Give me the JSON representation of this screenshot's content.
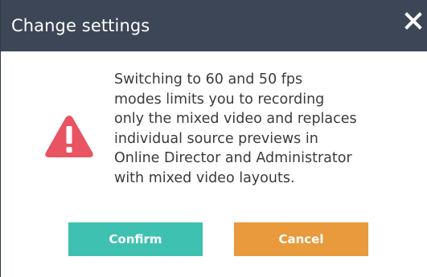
{
  "dialog": {
    "title": "Change settings",
    "close_icon": "close-icon",
    "warning_icon": "warning-icon",
    "message_lines": [
      "Switching to 60 and 50 fps",
      "modes limits you to recording",
      "only the mixed video and replaces",
      "individual source previews in",
      "Online Director and Administrator",
      "with mixed video layouts."
    ],
    "confirm_label": "Confirm",
    "cancel_label": "Cancel"
  },
  "colors": {
    "header_bg": "#3c4656",
    "confirm_bg": "#3ec1b0",
    "cancel_bg": "#e89a3c",
    "warning_red": "#e85462"
  }
}
